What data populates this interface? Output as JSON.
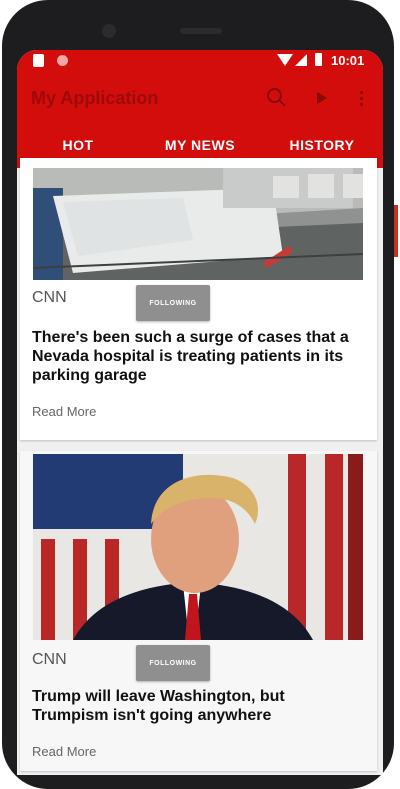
{
  "status_bar": {
    "time": "10:01"
  },
  "app_bar": {
    "title": "My Application",
    "icons": [
      "search-icon",
      "play-icon",
      "more-vert-icon"
    ],
    "color": "#d30c0c"
  },
  "tabs": [
    {
      "label": "HOT",
      "active": false
    },
    {
      "label": "MY NEWS",
      "active": true
    },
    {
      "label": "HISTORY",
      "active": false
    }
  ],
  "articles": [
    {
      "image": "hospital-beds-photo",
      "source": "CNN",
      "follow_label": "FOLLOWING",
      "headline": "There's been such a surge of cases that a Nevada hospital is treating patients in its parking garage",
      "read_more": "Read More"
    },
    {
      "image": "politician-portrait-photo",
      "source": "CNN",
      "follow_label": "FOLLOWING",
      "headline": "Trump will leave Washington, but Trumpism isn't going anywhere",
      "read_more": "Read More"
    }
  ]
}
